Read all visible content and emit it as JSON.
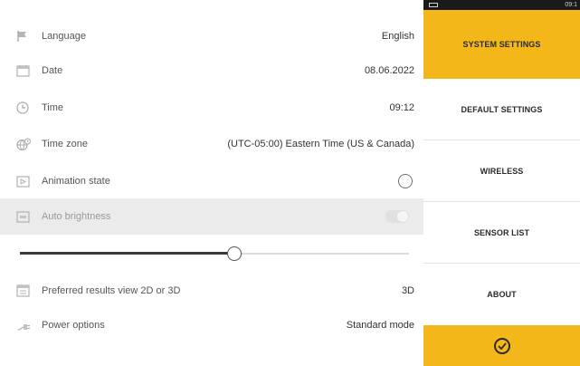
{
  "settings": {
    "rows": [
      {
        "label": "Language",
        "value": "English",
        "icon": "flag-icon"
      },
      {
        "label": "Date",
        "value": "08.06.2022",
        "icon": "calendar-icon"
      },
      {
        "label": "Time",
        "value": "09:12",
        "icon": "clock-icon"
      },
      {
        "label": "Time zone",
        "value": "(UTC-05:00) Eastern Time (US & Canada)",
        "icon": "globe-clock-icon"
      },
      {
        "label": "Animation state",
        "icon": "animation-icon",
        "toggle": "off"
      },
      {
        "label": "Auto brightness",
        "icon": "brightness-icon",
        "toggle": "disabled"
      },
      {
        "label": "Preferred results view 2D or 3D",
        "value": "3D",
        "icon": "view-3d-icon"
      },
      {
        "label": "Power options",
        "value": "Standard mode",
        "icon": "power-plug-icon"
      }
    ],
    "brightness_level": 0.55
  },
  "statusbar": {
    "time": "09:1"
  },
  "nav": {
    "items": [
      {
        "label": "SYSTEM SETTINGS",
        "active": true
      },
      {
        "label": "DEFAULT SETTINGS",
        "active": false
      },
      {
        "label": "WIRELESS",
        "active": false
      },
      {
        "label": "SENSOR LIST",
        "active": false
      },
      {
        "label": "ABOUT",
        "active": false
      }
    ],
    "confirm_icon": "check-circle-icon"
  },
  "colors": {
    "accent": "#f4b71a",
    "greyed_row": "#ebebeb"
  }
}
